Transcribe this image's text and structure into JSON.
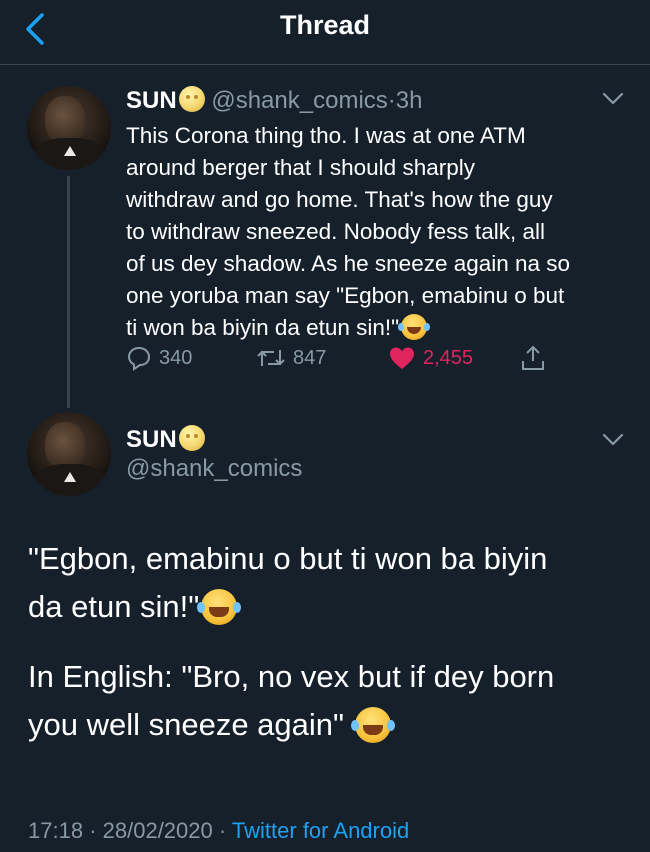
{
  "header": {
    "title": "Thread"
  },
  "parent_tweet": {
    "name": "SUN",
    "handle": "@shank_comics",
    "separator": "·",
    "time": "3h",
    "text_lines": [
      "This Corona thing tho. I was at one ATM",
      "around berger that I should sharply",
      "withdraw and go home. That's how the guy",
      "to withdraw sneezed. Nobody fess talk, all",
      "of us dey shadow. As he sneeze again na so",
      "one yoruba man say \"Egbon, emabinu o but",
      "ti won ba biyin da etun sin!\""
    ],
    "stats": {
      "replies": "340",
      "retweets": "847",
      "likes": "2,455"
    }
  },
  "main_tweet": {
    "name": "SUN",
    "handle": "@shank_comics",
    "paragraph1_lines": [
      "\"Egbon, emabinu o but ti won ba biyin",
      "da etun sin!\""
    ],
    "paragraph2_lines": [
      "In English: \"Bro, no vex but if dey born",
      "you well sneeze again\""
    ],
    "time": "17:18",
    "dot": "·",
    "date": "28/02/2020",
    "source": "Twitter for Android"
  },
  "colors": {
    "background": "#15202b",
    "accent": "#1da1f2",
    "secondary_text": "#8899a6",
    "like": "#e0245e",
    "divider": "#38444d"
  },
  "icons": {
    "back": "chevron-left-icon",
    "name_emoji": "moon-face-emoji",
    "laugh_emoji": "tears-of-joy-emoji",
    "reply": "reply-bubble-icon",
    "retweet": "retweet-icon",
    "like": "heart-filled-icon",
    "share": "share-icon",
    "more": "chevron-down-icon"
  }
}
